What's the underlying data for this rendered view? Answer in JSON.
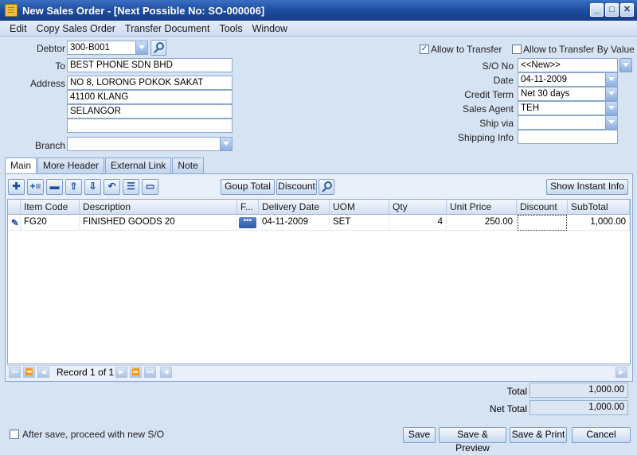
{
  "window": {
    "title": "New Sales Order - [Next Possible No: SO-000006]",
    "buttons": [
      "_",
      "□",
      "✕"
    ]
  },
  "menu": [
    "Edit",
    "Copy Sales Order",
    "Transfer Document",
    "Tools",
    "Window"
  ],
  "header": {
    "debtor_label": "Debtor",
    "debtor": "300-B001",
    "to_label": "To",
    "to": "BEST PHONE SDN BHD",
    "address_label": "Address",
    "address": [
      "NO 8, LORONG POKOK SAKAT",
      "41100 KLANG",
      "SELANGOR",
      ""
    ],
    "branch_label": "Branch",
    "branch": "",
    "allow_transfer_label": "Allow to Transfer",
    "allow_transfer": true,
    "allow_transfer_value_label": "Allow to Transfer By Value",
    "allow_transfer_value": false,
    "so_no_label": "S/O  No",
    "so_no": "<<New>>",
    "date_label": "Date",
    "date": "04-11-2009",
    "credit_term_label": "Credit Term",
    "credit_term": "Net 30 days",
    "sales_agent_label": "Sales Agent",
    "sales_agent": "TEH",
    "ship_via_label": "Ship via",
    "ship_via": "",
    "shipping_info_label": "Shipping Info",
    "shipping_info": ""
  },
  "tabs": [
    "Main",
    "More Header",
    "External Link",
    "Note"
  ],
  "toolbar": {
    "group_total": "Goup Total",
    "discount": "Discount",
    "instant_info": "Show Instant Info"
  },
  "grid": {
    "columns": [
      "Item Code",
      "Description",
      "F...",
      "Delivery Date",
      "UOM",
      "Qty",
      "Unit Price",
      "Discount",
      "SubTotal"
    ],
    "rows": [
      {
        "item_code": "FG20",
        "description": "FINISHED GOODS 20",
        "ellipsis": "•••",
        "delivery_date": "04-11-2009",
        "uom": "SET",
        "qty": "4",
        "unit_price": "250.00",
        "discount": "",
        "subtotal": "1,000.00"
      }
    ],
    "record_label": "Record 1 of 1"
  },
  "totals": {
    "total_label": "Total",
    "total": "1,000.00",
    "net_total_label": "Net Total",
    "net_total": "1,000.00"
  },
  "footer": {
    "proceed_label": "After save, proceed with new S/O",
    "save": "Save",
    "save_preview": "Save & Preview",
    "save_print": "Save & Print",
    "cancel": "Cancel"
  }
}
